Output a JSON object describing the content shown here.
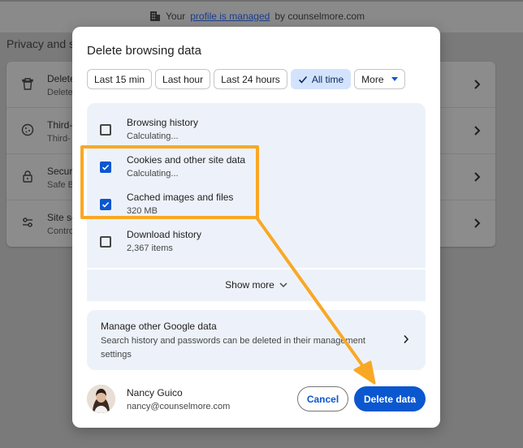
{
  "background": {
    "managed_prefix": "Your",
    "managed_link": "profile is managed",
    "managed_suffix": "by counselmore.com",
    "section_title": "Privacy and se",
    "rows": [
      {
        "title": "Delete",
        "subtitle": "Delete",
        "icon": "trash-icon"
      },
      {
        "title": "Third-",
        "subtitle": "Third-",
        "icon": "cookie-icon"
      },
      {
        "title": "Securi",
        "subtitle": "Safe B",
        "icon": "lock-icon"
      },
      {
        "title": "Site se",
        "subtitle": "Contro",
        "icon": "sliders-icon"
      }
    ]
  },
  "dialog": {
    "title": "Delete browsing data",
    "time_ranges": [
      {
        "label": "Last 15 min",
        "selected": false
      },
      {
        "label": "Last hour",
        "selected": false
      },
      {
        "label": "Last 24 hours",
        "selected": false
      },
      {
        "label": "All time",
        "selected": true
      },
      {
        "label": "More",
        "selected": false
      }
    ],
    "items": [
      {
        "name": "Browsing history",
        "detail": "Calculating...",
        "checked": false
      },
      {
        "name": "Cookies and other site data",
        "detail": "Calculating...",
        "checked": true
      },
      {
        "name": "Cached images and files",
        "detail": "320 MB",
        "checked": true
      },
      {
        "name": "Download history",
        "detail": "2,367 items",
        "checked": false
      }
    ],
    "show_more_label": "Show more",
    "manage": {
      "title": "Manage other Google data",
      "description": "Search history and passwords can be deleted in their management settings"
    },
    "user": {
      "name": "Nancy Guico",
      "email": "nancy@counselmore.com"
    },
    "cancel_label": "Cancel",
    "delete_label": "Delete data"
  },
  "colors": {
    "accent": "#0b57d0",
    "selected_chip": "#d3e3fd",
    "panel": "#edf2fa",
    "annotation": "#f9a825"
  }
}
